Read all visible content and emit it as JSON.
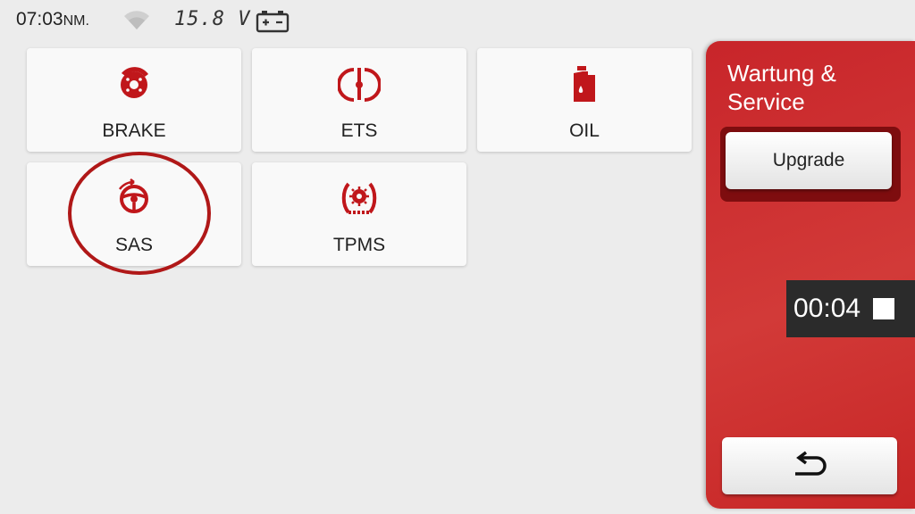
{
  "status_bar": {
    "time": "07:03",
    "time_suffix": "NM.",
    "voltage": "15.8 V"
  },
  "tiles": [
    {
      "label": "BRAKE",
      "icon": "brake-disc-icon"
    },
    {
      "label": "ETS",
      "icon": "throttle-icon"
    },
    {
      "label": "OIL",
      "icon": "oil-can-icon"
    },
    {
      "label": "SAS",
      "icon": "steering-wheel-icon"
    },
    {
      "label": "TPMS",
      "icon": "tire-pressure-icon"
    }
  ],
  "panel": {
    "title": "Wartung & Service",
    "upgrade_label": "Upgrade",
    "timer": "00:04",
    "back_icon": "return-arrow-icon"
  },
  "colors": {
    "accent": "#c8252a",
    "icon": "#c0171b"
  }
}
